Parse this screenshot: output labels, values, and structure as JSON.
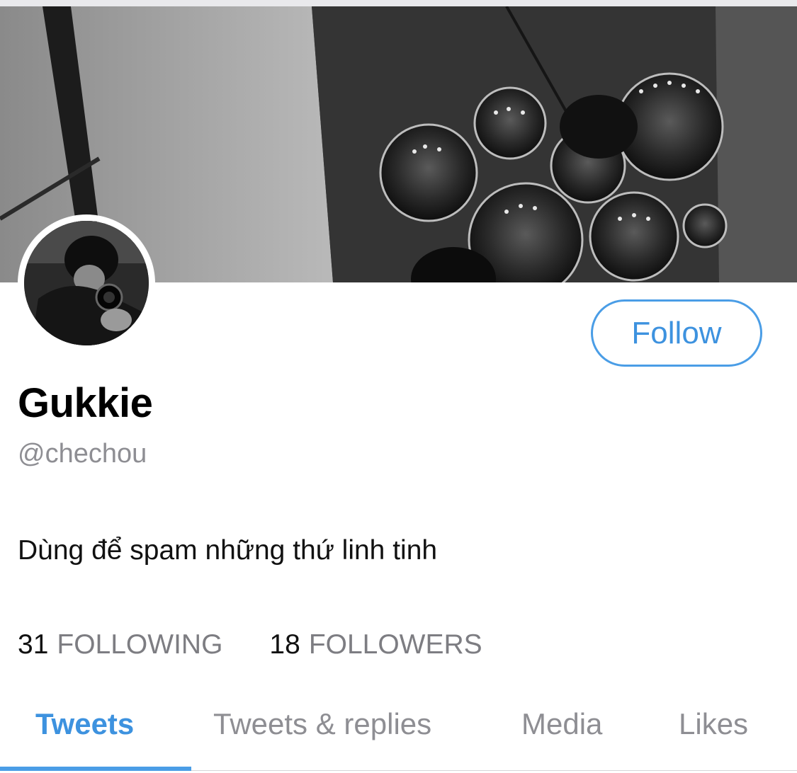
{
  "profile": {
    "display_name": "Gukkie",
    "handle": "@chechou",
    "bio": "Dùng để spam những thứ linh tinh",
    "follow_label": "Follow"
  },
  "stats": [
    {
      "count": "31",
      "label": "FOLLOWING"
    },
    {
      "count": "18",
      "label": "FOLLOWERS"
    }
  ],
  "tabs": [
    {
      "label": "Tweets",
      "active": true
    },
    {
      "label": "Tweets & replies",
      "active": false
    },
    {
      "label": "Media",
      "active": false
    },
    {
      "label": "Likes",
      "active": false
    }
  ],
  "colors": {
    "accent": "#4a9de6",
    "secondary_text": "#8e8e93",
    "primary_text": "#000000"
  }
}
